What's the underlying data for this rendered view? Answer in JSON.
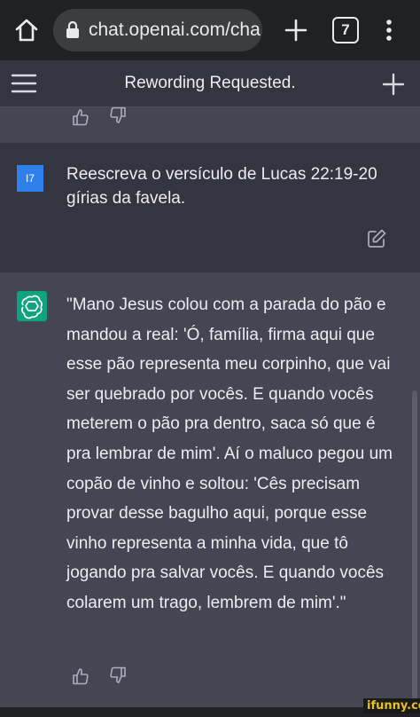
{
  "browser": {
    "url": "chat.openai.com/cha",
    "tab_count": "7"
  },
  "header": {
    "title": "Rewording Requested."
  },
  "user_message": {
    "avatar_label": "I7",
    "text": "Reescreva o versículo de Lucas 22:19-20 gírias da favela."
  },
  "assistant_message": {
    "text": "\"Mano Jesus colou com a parada do pão e mandou a real: 'Ó, família, firma aqui que esse pão representa meu corpinho, que vai ser quebrado por vocês. E quando vocês meterem o pão pra dentro, saca só que é pra lembrar de mim'. Aí o maluco pegou um copão de vinho e soltou: 'Cês precisam provar desse bagulho aqui, porque esse vinho representa a minha vida, que tô jogando pra salvar vocês. E quando vocês colarem um trago, lembrem de mim'.\""
  },
  "watermark": "ifunny.co",
  "colors": {
    "accent_user": "#2f80ed",
    "accent_gpt": "#10a37f",
    "bg_assistant": "#444654",
    "bg_user": "#343541"
  },
  "icons": [
    "home-icon",
    "lock-icon",
    "plus-icon",
    "tab-switcher-icon",
    "more-vert-icon",
    "hamburger-icon",
    "thumbs-up-icon",
    "thumbs-down-icon",
    "edit-icon",
    "openai-logo-icon"
  ]
}
